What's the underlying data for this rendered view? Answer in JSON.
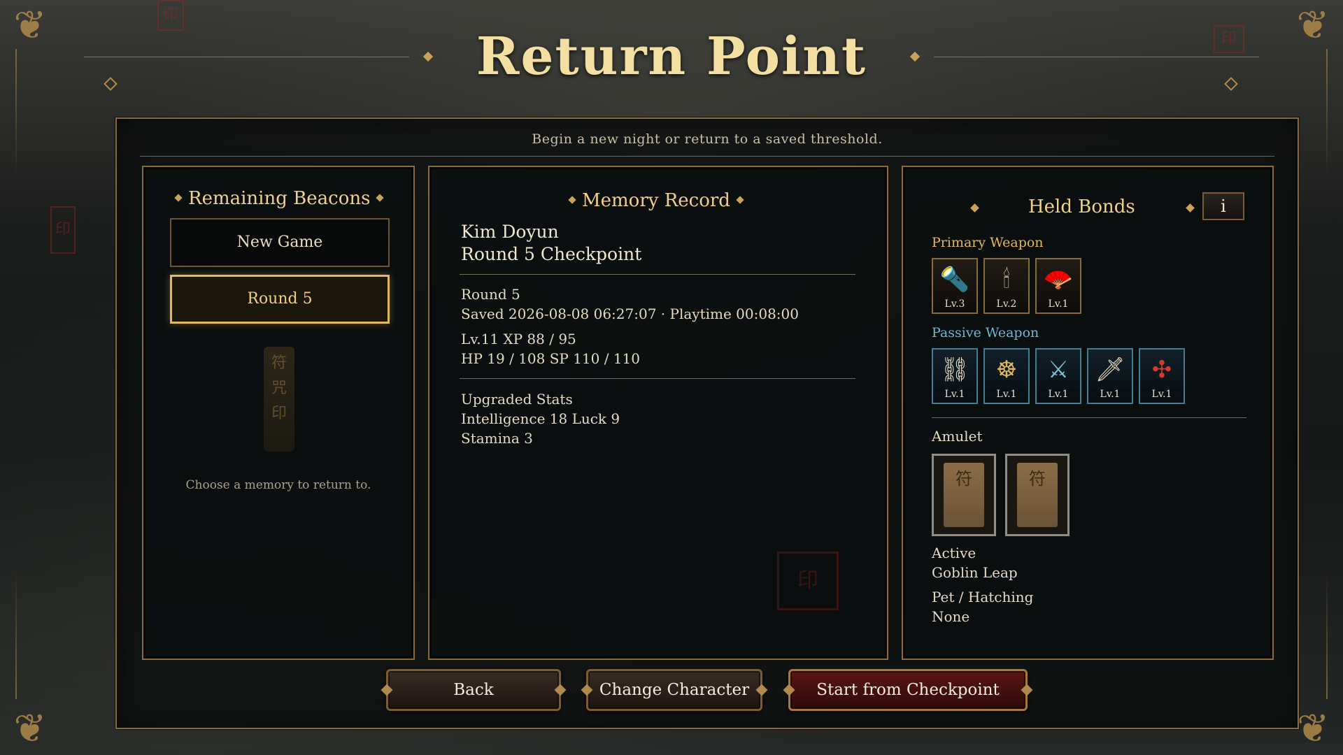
{
  "title": "Return Point",
  "subtitle": "Begin a new night or return to a saved threshold.",
  "beacons": {
    "heading": "Remaining Beacons",
    "new_game_label": "New Game",
    "round_label": "Round 5",
    "hint": "Choose a memory to return to."
  },
  "memory": {
    "heading": "Memory Record",
    "character": "Kim Doyun",
    "checkpoint": "Round 5 Checkpoint",
    "round": "Round 5",
    "saved": "Saved 2026-08-08 06:27:07 · Playtime 00:08:00",
    "level_xp": "Lv.11  XP 88 / 95",
    "hp_sp": "HP 19 / 108  SP 110 / 110",
    "upgraded_heading": "Upgraded Stats",
    "upgraded_line1": "Intelligence 18  Luck 9",
    "upgraded_line2": "Stamina 3"
  },
  "bonds": {
    "heading": "Held Bonds",
    "info_label": "i",
    "primary_label": "Primary Weapon",
    "primary": [
      {
        "icon": "flashlight-icon",
        "glyph": "🔦",
        "level": "Lv.3"
      },
      {
        "icon": "twin-candles-icon",
        "glyph": "🕯",
        "level": "Lv.2"
      },
      {
        "icon": "fire-fan-icon",
        "glyph": "🪭",
        "level": "Lv.1"
      }
    ],
    "passive_label": "Passive Weapon",
    "passive": [
      {
        "icon": "armored-disc-icon",
        "glyph": "⛓",
        "level": "Lv.1"
      },
      {
        "icon": "spirit-ring-icon",
        "glyph": "☸",
        "level": "Lv.1"
      },
      {
        "icon": "crossed-shield-icon",
        "glyph": "⚔",
        "level": "Lv.1"
      },
      {
        "icon": "blue-dagger-icon",
        "glyph": "🗡",
        "level": "Lv.1"
      },
      {
        "icon": "red-charm-icon",
        "glyph": "✣",
        "level": "Lv.1"
      }
    ],
    "amulet_label": "Amulet",
    "amulets": [
      {
        "icon": "talisman-card-icon",
        "glyph": "符"
      },
      {
        "icon": "talisman-card-icon",
        "glyph": "符"
      }
    ],
    "active_label": "Active",
    "active_value": "Goblin Leap",
    "pet_label": "Pet / Hatching",
    "pet_value": "None"
  },
  "actions": {
    "back": "Back",
    "change_character": "Change Character",
    "start": "Start from Checkpoint"
  },
  "colors": {
    "accent_gold": "#e0b860",
    "title_gold": "#f3dfa2",
    "passive_blue": "#6fb6d4",
    "primary_red": "#5a1712"
  }
}
